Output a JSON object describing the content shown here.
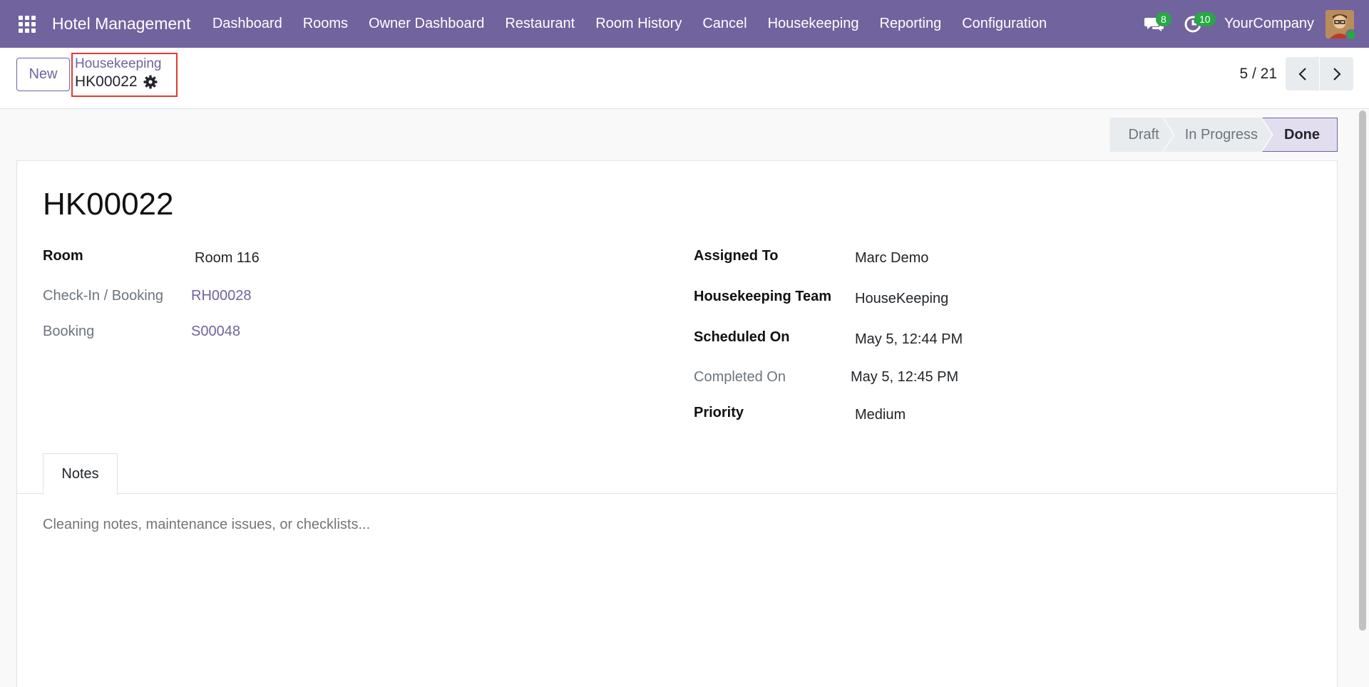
{
  "navbar": {
    "brand": "Hotel Management",
    "menu": [
      "Dashboard",
      "Rooms",
      "Owner Dashboard",
      "Restaurant",
      "Room History",
      "Cancel",
      "Housekeeping",
      "Reporting",
      "Configuration"
    ],
    "messages_count": "8",
    "activities_count": "10",
    "company": "YourCompany",
    "color": "#71639e"
  },
  "control": {
    "new_label": "New",
    "breadcrumb_parent": "Housekeeping",
    "breadcrumb_current": "HK00022",
    "pager": "5 / 21"
  },
  "statusbar": {
    "stages": [
      "Draft",
      "In Progress",
      "Done"
    ],
    "active": "Done"
  },
  "record": {
    "title": "HK00022",
    "left_fields": [
      {
        "label": "Room",
        "value": "Room 116"
      },
      {
        "label": "Check-In / Booking",
        "value": "RH00028"
      },
      {
        "label": "Booking",
        "value": "S00048"
      }
    ],
    "right_fields": [
      {
        "label": "Assigned To",
        "value": "Marc Demo"
      },
      {
        "label": "Housekeeping Team",
        "value": "HouseKeeping"
      },
      {
        "label": "Scheduled On",
        "value": "May 5, 12:44 PM"
      },
      {
        "label": "Completed On",
        "value": "May 5, 12:45 PM"
      },
      {
        "label": "Priority",
        "value": "Medium"
      }
    ]
  },
  "tabs": {
    "notes_label": "Notes",
    "notes_placeholder": "Cleaning notes, maintenance issues, or checklists..."
  }
}
